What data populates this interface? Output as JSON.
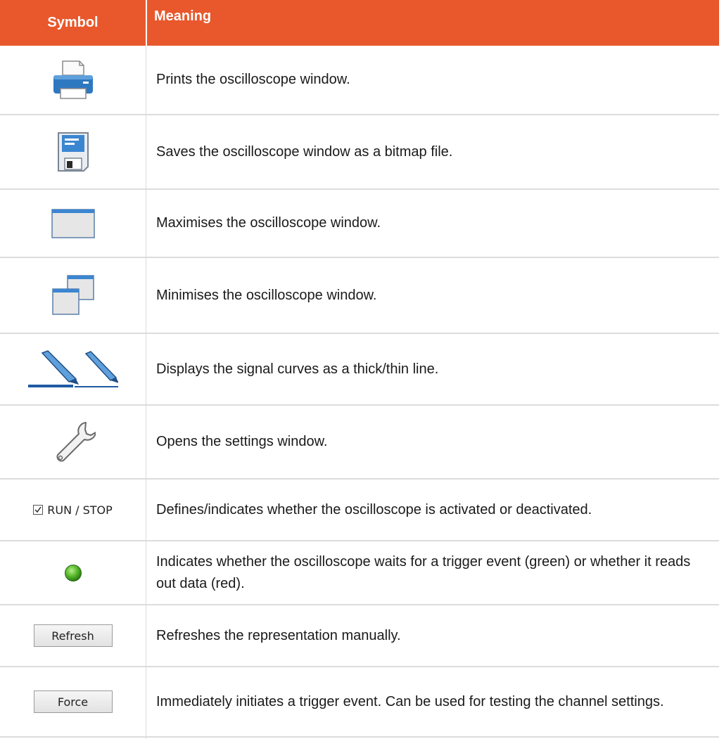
{
  "header": {
    "symbol": "Symbol",
    "meaning": "Meaning"
  },
  "rows": [
    {
      "icon": "printer-icon",
      "text": "Prints the oscilloscope window."
    },
    {
      "icon": "floppy-disk-icon",
      "text": "Saves the oscilloscope window as a bitmap file."
    },
    {
      "icon": "maximise-window-icon",
      "text": "Maximises the oscilloscope window."
    },
    {
      "icon": "minimise-window-icon",
      "text": "Minimises the oscilloscope window."
    },
    {
      "icon": "pencil-line-thickness-icon",
      "text": "Displays the signal curves as a thick/thin line."
    },
    {
      "icon": "wrench-icon",
      "text": "Opens the settings window."
    },
    {
      "icon": "run-stop-checkbox",
      "label": "RUN / STOP",
      "text": "Defines/indicates whether the oscilloscope is activated or deactivated."
    },
    {
      "icon": "green-status-led-icon",
      "text": "Indicates whether the oscilloscope waits for a trigger event (green) or whether it reads out data (red)."
    },
    {
      "icon": "refresh-button",
      "label": "Refresh",
      "text": "Refreshes the representation manually."
    },
    {
      "icon": "force-button",
      "label": "Force",
      "text": "Immediately initiates a trigger event. Can be used for testing the channel settings."
    }
  ],
  "colors": {
    "header_bg": "#e8582c",
    "header_text": "#ffffff",
    "icon_blue": "#2a6fb5",
    "led_green": "#56b82b"
  }
}
